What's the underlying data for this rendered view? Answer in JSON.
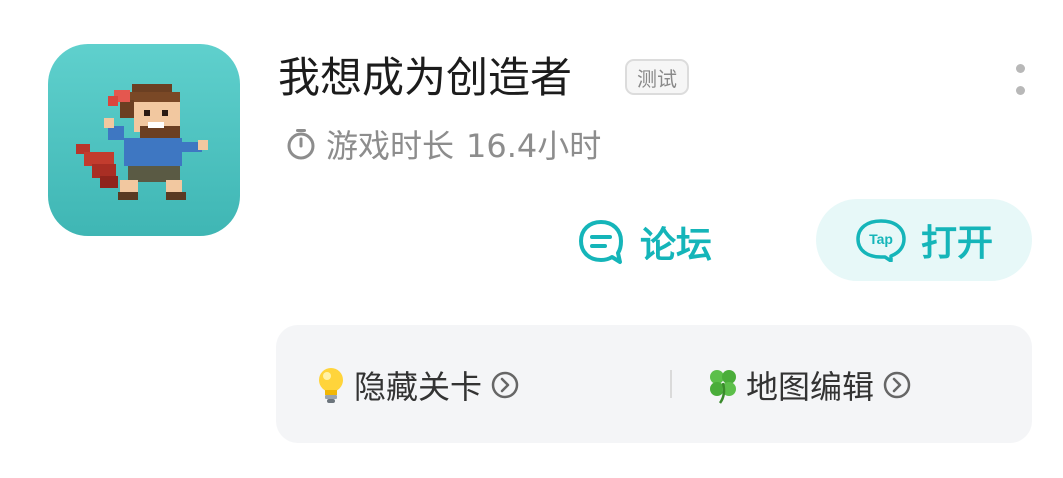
{
  "app": {
    "name": "我想成为创造者",
    "status_badge": "测试",
    "icon": "pixel-hero-app-icon"
  },
  "playtime": {
    "label": "游戏时长",
    "value": "16.4小时",
    "icon": "timer-icon"
  },
  "actions": {
    "forum_label": "论坛",
    "open_label": "打开",
    "forum_icon": "chat-bubble-icon",
    "open_icon": "tap-logo-icon"
  },
  "shortcuts": [
    {
      "label": "隐藏关卡",
      "icon": "lightbulb-icon"
    },
    {
      "label": "地图编辑",
      "icon": "four-leaf-clover-icon"
    }
  ],
  "colors": {
    "accent": "#15b5b9",
    "accent_bg": "#e7f8f8",
    "icon_bg": "#4fc4c2",
    "panel_bg": "#f4f5f7",
    "muted_text": "#8d8d8d"
  }
}
